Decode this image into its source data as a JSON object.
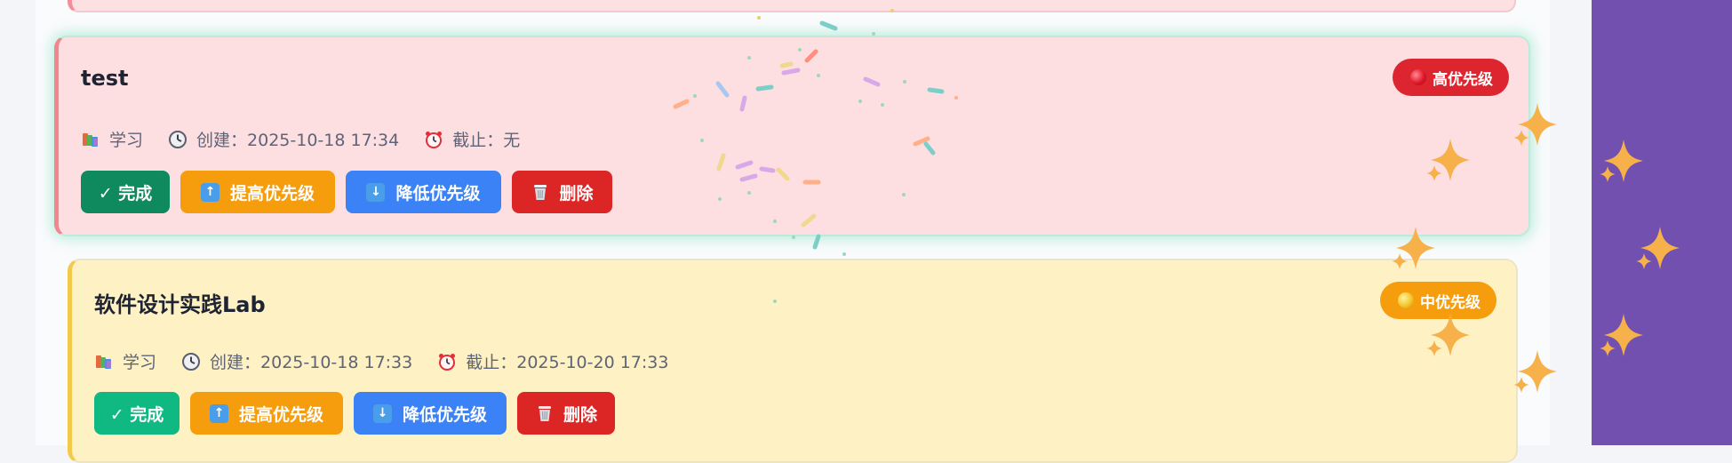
{
  "tasks": [
    {
      "title": "test",
      "priority": "高优先级",
      "category": "学习",
      "created": "创建：2025-10-18 17:34",
      "deadline": "截止：无",
      "actions": {
        "complete": "✓ 完成",
        "raise": "提高优先级",
        "lower": "降低优先级",
        "delete": "删除"
      }
    },
    {
      "title": "软件设计实践Lab",
      "priority": "中优先级",
      "category": "学习",
      "created": "创建：2025-10-18 17:33",
      "deadline": "截止：2025-10-20 17:33",
      "actions": {
        "complete": "✓ 完成",
        "raise": "提高优先级",
        "lower": "降低优先级",
        "delete": "删除"
      }
    }
  ],
  "icons": {
    "category": "books-icon",
    "created": "clock-icon",
    "deadline": "alarm-clock-icon",
    "raise": "up-arrow-icon",
    "lower": "down-arrow-icon",
    "delete": "wastebasket-icon",
    "decoration": "sparkles-icon"
  },
  "colors": {
    "high_priority": "#dd2530",
    "mid_priority": "#f59d0c",
    "complete_high": "#0f8a5f",
    "complete_mid": "#10b981",
    "raise": "#f59d0c",
    "lower": "#3b82f6",
    "delete": "#dc2626",
    "side_panel": "#7150b0"
  }
}
